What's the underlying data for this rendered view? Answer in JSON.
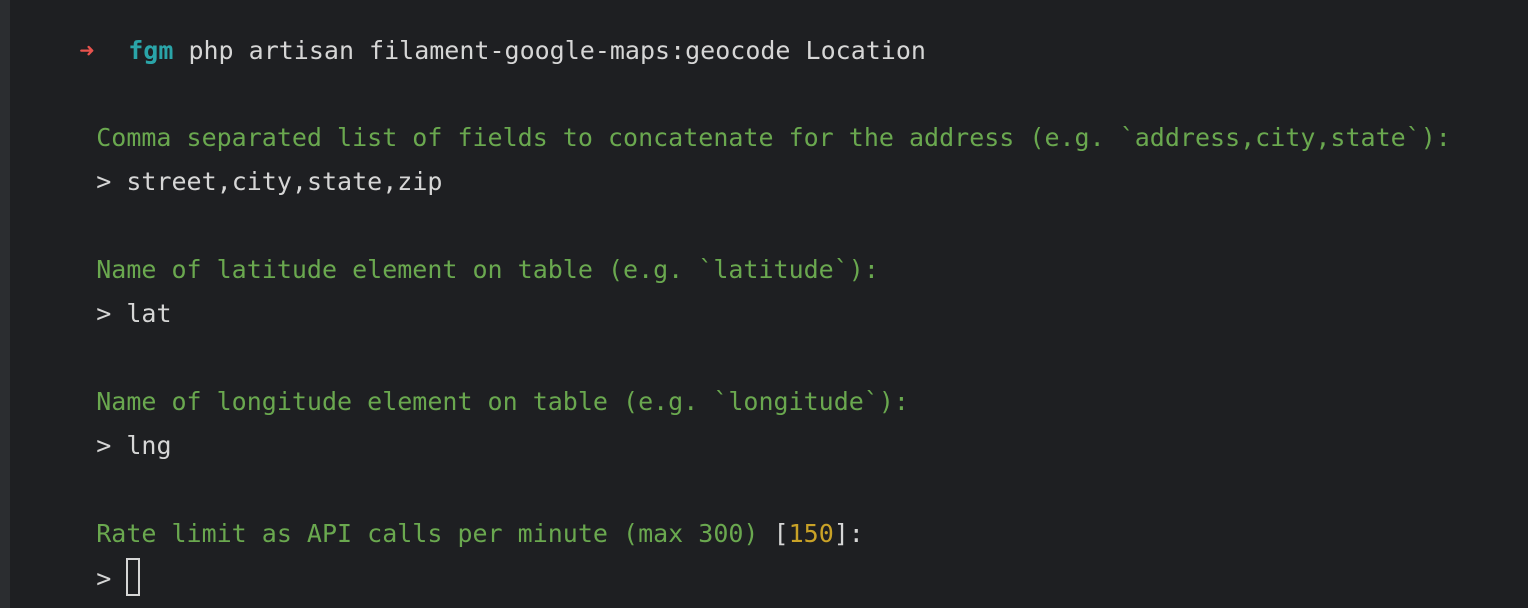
{
  "prompt": {
    "arrow": "➜",
    "directory": "fgm",
    "command": "php artisan filament-google-maps:geocode Location"
  },
  "questions": [
    {
      "text": "Comma separated list of fields to concatenate for the address (e.g. `address,city,state`):",
      "answer_prefix": ">",
      "answer": "street,city,state,zip"
    },
    {
      "text": "Name of latitude element on table (e.g. `latitude`):",
      "answer_prefix": ">",
      "answer": "lat"
    },
    {
      "text": "Name of longitude element on table (e.g. `longitude`):",
      "answer_prefix": ">",
      "answer": "lng"
    },
    {
      "text": "Rate limit as API calls per minute (max 300) ",
      "default_open": "[",
      "default_value": "150",
      "default_close": "]:",
      "answer_prefix": ">",
      "answer": ""
    }
  ]
}
